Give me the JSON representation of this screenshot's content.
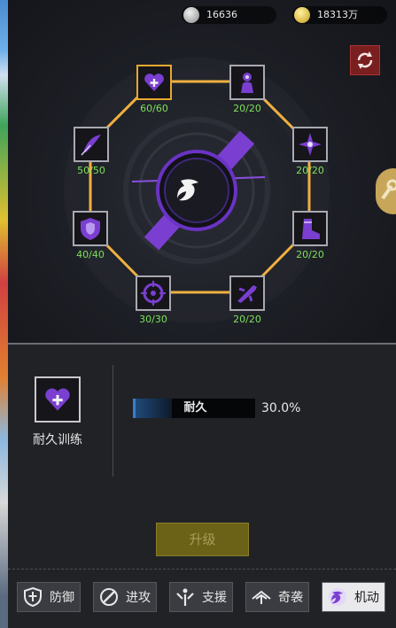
{
  "currency": {
    "silver": "16636",
    "gold": "18313万"
  },
  "colors": {
    "node_border_selected": "#e8a830",
    "ring": "#f0b040",
    "level_text": "#7ee05a",
    "icon_purple": "#7a3fd0"
  },
  "nodes": [
    {
      "icon": "heart-plus-icon",
      "level": "60/60",
      "selected": true
    },
    {
      "icon": "soldier-icon",
      "level": "20/20"
    },
    {
      "icon": "compass-star-icon",
      "level": "20/20"
    },
    {
      "icon": "boot-icon",
      "level": "20/20"
    },
    {
      "icon": "jet-icon",
      "level": "20/20"
    },
    {
      "icon": "crosshair-icon",
      "level": "30/30"
    },
    {
      "icon": "shield-icon",
      "level": "40/40"
    },
    {
      "icon": "feather-icon",
      "level": "50/50"
    }
  ],
  "center": {
    "icon": "running-emblem-icon"
  },
  "selected": {
    "name": "耐久训练"
  },
  "stat": {
    "name": "耐久",
    "value": "30.0%",
    "fraction": 0.3
  },
  "upgrade_label": "升级",
  "tabs": [
    {
      "label": "防御",
      "icon": "shield-tab-icon"
    },
    {
      "label": "进攻",
      "icon": "attack-tab-icon"
    },
    {
      "label": "支援",
      "icon": "support-tab-icon"
    },
    {
      "label": "奇袭",
      "icon": "raid-tab-icon"
    },
    {
      "label": "机动",
      "icon": "mobility-tab-icon",
      "active": true
    }
  ]
}
